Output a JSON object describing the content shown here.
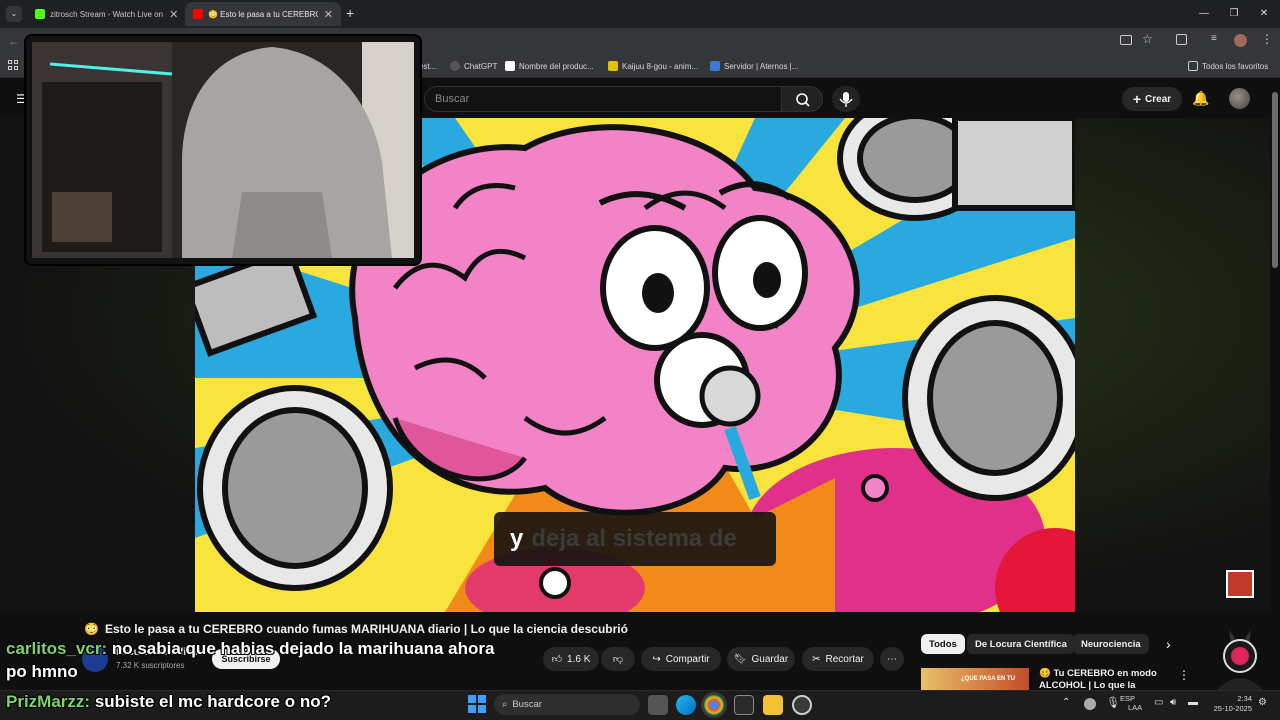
{
  "browser": {
    "tabs": [
      {
        "label": "zitrosch Stream - Watch Live on",
        "active": false,
        "favicon_color": "#53fc18"
      },
      {
        "label": "😳 Esto le pasa a tu CEREBRO c",
        "active": true,
        "favicon_color": "#ff0000"
      }
    ],
    "bookmarks": [
      {
        "label": "est..."
      },
      {
        "label": "ChatGPT"
      },
      {
        "label": "Nombre del produc..."
      },
      {
        "label": "Kaijuu 8-gou - anim..."
      },
      {
        "label": "Servidor | Aternos |..."
      }
    ],
    "all_bookmarks_label": "Todos los favoritos"
  },
  "youtube": {
    "search_placeholder": "Buscar",
    "create_label": "Crear",
    "subtitle_word_active": "y",
    "subtitle_rest": "deja al sistema de",
    "video_title": "Esto le pasa a tu CEREBRO cuando fumas MARIHUANA diario | Lo que la ciencia descubrió",
    "title_emoji": "😳",
    "channel_name": "Locura Científica",
    "subscribers": "7.32 K suscriptores",
    "subscribe_label": "Suscribirse",
    "likes": "1.6 K",
    "share_label": "Compartir",
    "save_label": "Guardar",
    "clip_label": "Recortar",
    "chips": [
      "Todos",
      "De Locura Científica",
      "Neurociencia"
    ],
    "recommended_title": "Tu CEREBRO en modo ALCOHOL | Lo que la ciencia",
    "recommended_thumb_text": "¿QUE PASA EN TU"
  },
  "chat": [
    {
      "user": "carlitos_vcr:",
      "message": "no sabia que habias dejado la marihuana ahora"
    },
    {
      "user": "",
      "message": "po hmno"
    },
    {
      "user": "PrizMarzz:",
      "message": "subiste el mc hardcore o no?"
    }
  ],
  "taskbar": {
    "search_placeholder": "Buscar",
    "lang_top": "ESP",
    "lang_bottom": "LAA",
    "date": "25-10-2025",
    "time": "2:34"
  },
  "colors": {
    "accent_kick": "#53fc18",
    "youtube_red": "#ff0000",
    "chat_user": "#7ed36b"
  }
}
